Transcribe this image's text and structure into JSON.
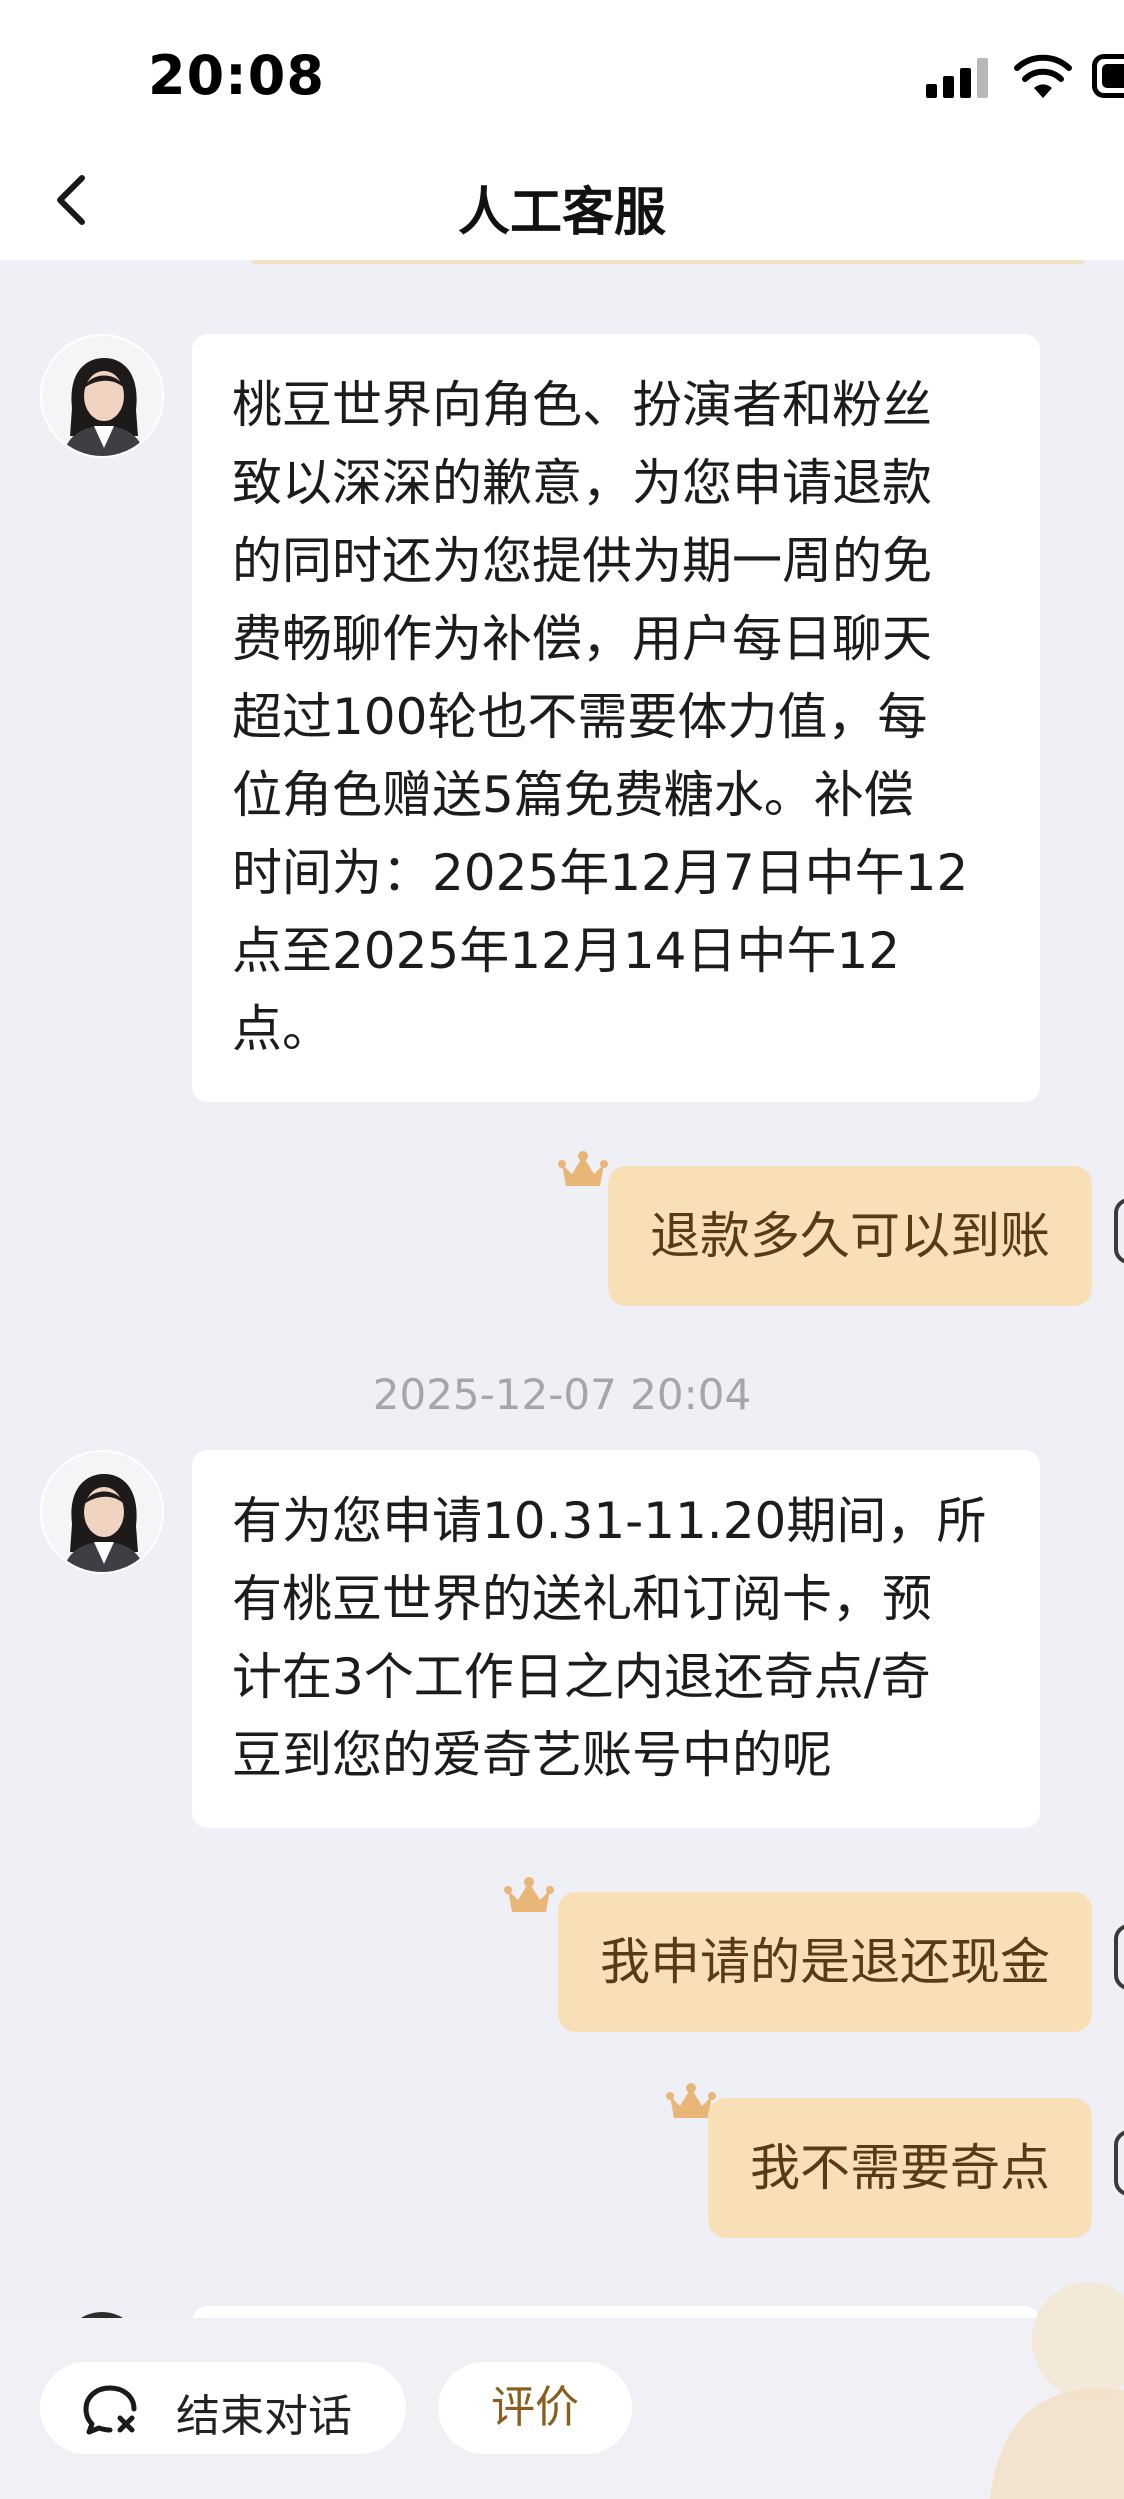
{
  "status_bar": {
    "time": "20:08"
  },
  "nav": {
    "title": "人工客服"
  },
  "messages": [
    {
      "side": "agent",
      "text": "桃豆世界向角色、扮演者和粉丝\n致以深深的歉意，为您申请退款\n的同时还为您提供为期一周的免\n费畅聊作为补偿，用户每日聊天\n超过100轮也不需要体力值，每\n位角色赠送5篇免费糖水。补偿\n时间为：2025年12月7日中午12\n点至2025年12月14日中午12\n点。"
    },
    {
      "side": "user",
      "text": "退款多久可以到账"
    },
    {
      "side": "timestamp",
      "text": "2025-12-07 20:04"
    },
    {
      "side": "agent",
      "text": "有为您申请10.31-11.20期间，所\n有桃豆世界的送礼和订阅卡，预\n计在3个工作日之内退还奇点/奇\n豆到您的爱奇艺账号中的呢"
    },
    {
      "side": "user",
      "text": "我申请的是退还现金"
    },
    {
      "side": "user",
      "text": "我不需要奇点"
    }
  ],
  "bottom": {
    "end_chat_label": "结束对话",
    "rate_label": "评价"
  },
  "colors": {
    "user_bubble": "#f9dfb6",
    "user_text": "#5a3a16",
    "background": "#eff0f5",
    "accent": "#8a5e1c"
  },
  "icons": [
    "back-arrow-icon",
    "signal-icon",
    "wifi-icon",
    "battery-icon",
    "crown-icon",
    "chat-end-icon"
  ]
}
